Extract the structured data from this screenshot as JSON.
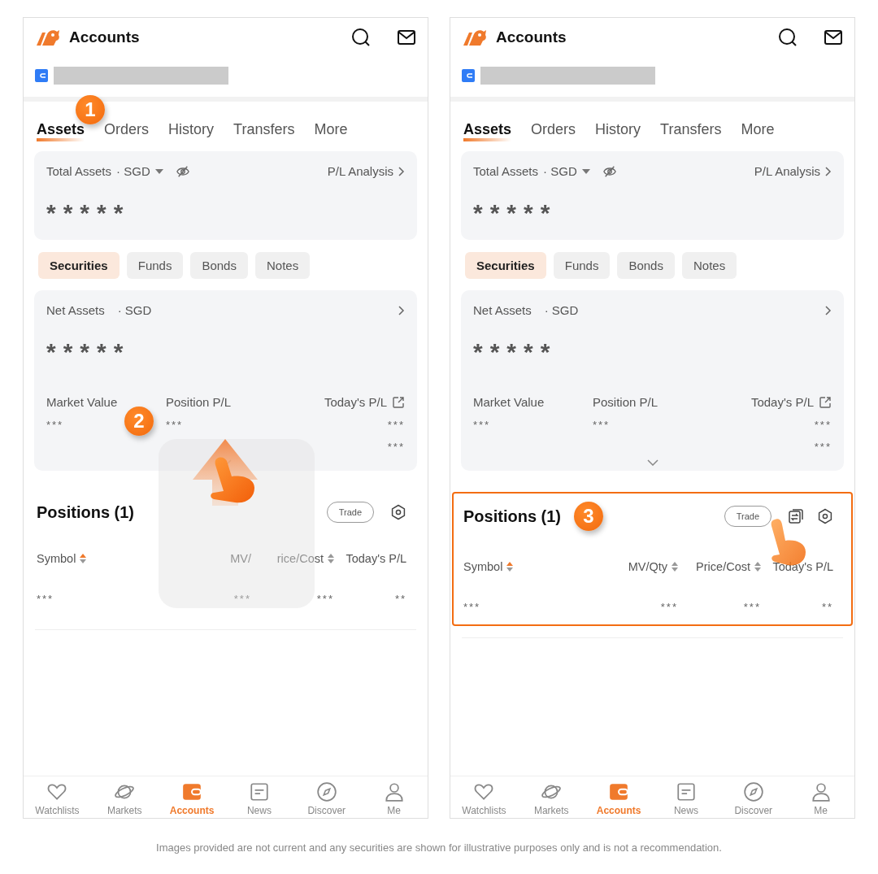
{
  "screens": [
    {
      "header": {
        "title": "Accounts"
      },
      "tabs": [
        {
          "label": "Assets",
          "selected": true
        },
        {
          "label": "Orders",
          "selected": false
        },
        {
          "label": "History",
          "selected": false
        },
        {
          "label": "Transfers",
          "selected": false
        },
        {
          "label": "More",
          "selected": false
        }
      ],
      "tab_badge": "1",
      "total_assets": {
        "label": "Total Assets",
        "currency": "· SGD",
        "link": "P/L Analysis",
        "value": "*****"
      },
      "chips": [
        {
          "label": "Securities",
          "selected": true
        },
        {
          "label": "Funds",
          "selected": false
        },
        {
          "label": "Bonds",
          "selected": false
        },
        {
          "label": "Notes",
          "selected": false
        }
      ],
      "net_assets": {
        "label": "Net Assets",
        "currency": "· SGD",
        "value": "*****",
        "metrics": [
          {
            "label": "Market Value",
            "values": [
              "***"
            ]
          },
          {
            "label": "Position P/L",
            "values": [
              "***"
            ]
          },
          {
            "label": "Today's P/L",
            "share_link": true,
            "values": [
              "***",
              "***"
            ]
          }
        ]
      },
      "swipe_hint": {
        "badge": "2"
      },
      "positions": {
        "title": "Positions (1)",
        "actions": [
          {
            "kind": "trade",
            "label": "Trade"
          },
          {
            "kind": "settings"
          }
        ],
        "columns": [
          {
            "label": "Symbol",
            "sortable": true,
            "sorted": true
          },
          {
            "label": "MV/",
            "sortable": false
          },
          {
            "label": "rice/Cost",
            "sortable": true,
            "sorted": false
          },
          {
            "label": "Today's P/L",
            "sortable": false
          }
        ],
        "rows": [
          [
            "***",
            "***",
            "***",
            "**"
          ]
        ]
      },
      "nav": [
        {
          "label": "Watchlists",
          "selected": false
        },
        {
          "label": "Markets",
          "selected": false
        },
        {
          "label": "Accounts",
          "selected": true
        },
        {
          "label": "News",
          "selected": false
        },
        {
          "label": "Discover",
          "selected": false
        },
        {
          "label": "Me",
          "selected": false
        }
      ]
    },
    {
      "header": {
        "title": "Accounts"
      },
      "tabs": [
        {
          "label": "Assets",
          "selected": true
        },
        {
          "label": "Orders",
          "selected": false
        },
        {
          "label": "History",
          "selected": false
        },
        {
          "label": "Transfers",
          "selected": false
        },
        {
          "label": "More",
          "selected": false
        }
      ],
      "total_assets": {
        "label": "Total Assets",
        "currency": "· SGD",
        "link": "P/L Analysis",
        "value": "*****"
      },
      "chips": [
        {
          "label": "Securities",
          "selected": true
        },
        {
          "label": "Funds",
          "selected": false
        },
        {
          "label": "Bonds",
          "selected": false
        },
        {
          "label": "Notes",
          "selected": false
        }
      ],
      "net_assets": {
        "label": "Net Assets",
        "currency": "· SGD",
        "value": "*****",
        "metrics": [
          {
            "label": "Market Value",
            "values": [
              "***"
            ]
          },
          {
            "label": "Position P/L",
            "values": [
              "***"
            ]
          },
          {
            "label": "Today's P/L",
            "share_link": true,
            "values": [
              "***",
              "***"
            ]
          }
        ]
      },
      "positions": {
        "title": "Positions (1)",
        "badge": "3",
        "highlighted": true,
        "tap_hint": true,
        "actions": [
          {
            "kind": "trade",
            "label": "Trade"
          },
          {
            "kind": "swap"
          },
          {
            "kind": "settings"
          }
        ],
        "columns": [
          {
            "label": "Symbol",
            "sortable": true,
            "sorted": true
          },
          {
            "label": "MV/Qty",
            "sortable": true,
            "sorted": false
          },
          {
            "label": "Price/Cost",
            "sortable": true,
            "sorted": false
          },
          {
            "label": "Today's P/L",
            "sortable": false
          }
        ],
        "rows": [
          [
            "***",
            "***",
            "***",
            "**"
          ]
        ]
      },
      "nav": [
        {
          "label": "Watchlists",
          "selected": false
        },
        {
          "label": "Markets",
          "selected": false
        },
        {
          "label": "Accounts",
          "selected": true
        },
        {
          "label": "News",
          "selected": false
        },
        {
          "label": "Discover",
          "selected": false
        },
        {
          "label": "Me",
          "selected": false
        }
      ]
    }
  ],
  "footnote": "Images provided are not current and any securities are shown for illustrative purposes only and is not a recommendation."
}
